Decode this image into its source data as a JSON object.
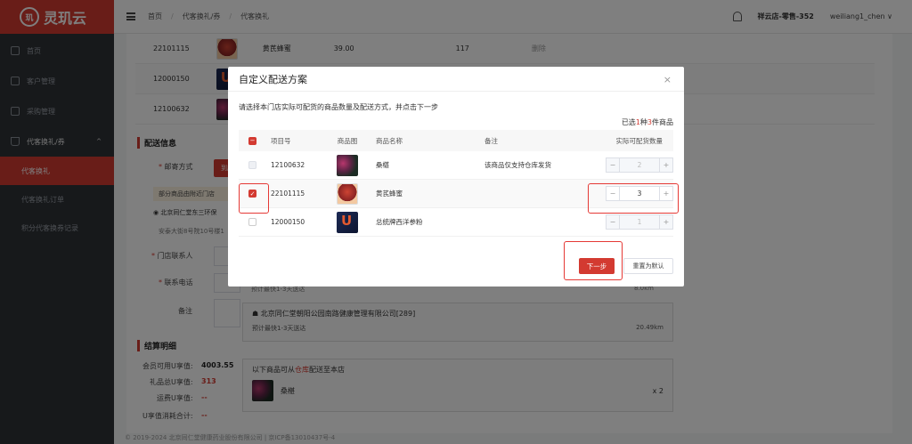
{
  "app": {
    "name": "灵玑云",
    "logo_text": "玑"
  },
  "sidebar": {
    "items": [
      {
        "label": "首页"
      },
      {
        "label": "客户管理"
      },
      {
        "label": "采购管理"
      },
      {
        "label": "代客换礼/券"
      }
    ],
    "subitems": [
      {
        "label": "代客换礼"
      },
      {
        "label": "代客换礼订单"
      },
      {
        "label": "积分代客换券记录"
      }
    ],
    "caret": "^"
  },
  "topbar": {
    "breadcrumb": [
      "首页",
      "代客换礼/券",
      "代客换礼"
    ],
    "store": "祥云店-零售-352",
    "user": "weiliang1_chen ∨"
  },
  "background": {
    "rows": [
      {
        "code": "22101115",
        "name": "黄芪蜂蜜",
        "price": "39.00",
        "stock": "117",
        "extra": "删除"
      },
      {
        "code": "12000150"
      },
      {
        "code": "12100632"
      }
    ],
    "delivery_title": "配送信息",
    "mail_label": "邮寄方式",
    "mail_button": "到店自",
    "notice": "部分商品由附近门店",
    "address": "北京同仁堂东三环保",
    "address2": "安泰大街8号院10号楼1",
    "contact_label": "门店联系人",
    "phone_label": "联系电话",
    "remark_label": "备注",
    "store_text": "北京同仁堂朝阳公园南路健康管理有限公司[289]",
    "store_eta": "预计最快1-3天送达",
    "store_distance": "20.49km",
    "ghost_eta": "预计最快1-3天送达",
    "ghost_distance": "8.0km",
    "settle_title": "结算明细",
    "member_label": "会员可用U享值:",
    "member_value": "4003.55",
    "gift_label": "礼品总U享值:",
    "gift_value": "313",
    "freight_label": "运费U享值:",
    "freight_value": "--",
    "consume_label": "U享值消耗合计:",
    "consume_value": "--",
    "warehouse_text_pre": "以下商品可从",
    "warehouse_word": "仓库",
    "warehouse_text_post": "配送至本店",
    "warehouse_item": "桑椹",
    "warehouse_qty": "x 2"
  },
  "footer": "© 2019-2024 北京同仁堂健康药业股份有限公司 | 京ICP备13010437号-4",
  "modal": {
    "title": "自定义配送方案",
    "close": "×",
    "desc": "请选择本门店实际可配货的商品数量及配送方式，并点击下一步",
    "count_pre": "已选",
    "count_sel": "1",
    "count_mid": "种",
    "count_total": "3",
    "count_post": "件商品",
    "headers": [
      "项目号",
      "商品图",
      "商品名称",
      "备注",
      "实际可配货数量"
    ],
    "rows": [
      {
        "code": "12100632",
        "name": "桑椹",
        "note": "该商品仅支持仓库发货",
        "qty": "2"
      },
      {
        "code": "22101115",
        "name": "黄芪蜂蜜",
        "note": "",
        "qty": "3"
      },
      {
        "code": "12000150",
        "name": "总统牌西洋参粉",
        "note": "",
        "qty": "1"
      }
    ],
    "minus": "−",
    "plus": "+",
    "check": "✓",
    "next": "下一步",
    "reset": "重置为默认"
  }
}
